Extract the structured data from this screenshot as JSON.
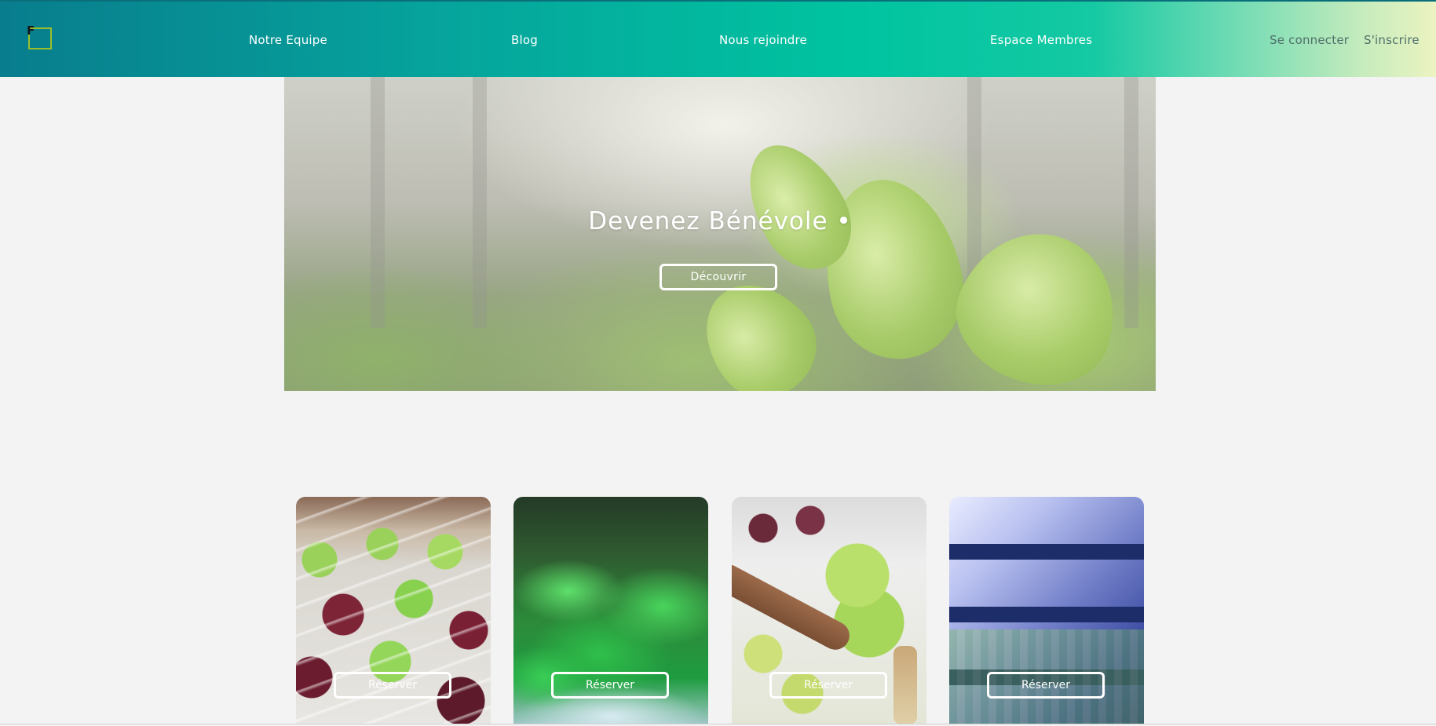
{
  "header": {
    "logo_letter": "F",
    "nav": [
      "Notre Equipe",
      "Blog",
      "Nous rejoindre",
      "Espace Membres"
    ],
    "login_label": "Se connecter",
    "signup_label": "S'inscrire"
  },
  "hero": {
    "title": "Devenez Bénévole",
    "button_label": "Découvrir"
  },
  "cards": [
    {
      "button_label": "Réserver"
    },
    {
      "button_label": "Réserver"
    },
    {
      "button_label": "Réserver"
    },
    {
      "button_label": "Réserver"
    }
  ],
  "colors": {
    "header_start": "#087d8d",
    "header_mid": "#00c4a0",
    "header_end": "#ecf3c1",
    "page_bg": "#f3f3f3",
    "logo_accent": "#9bbf2b"
  }
}
